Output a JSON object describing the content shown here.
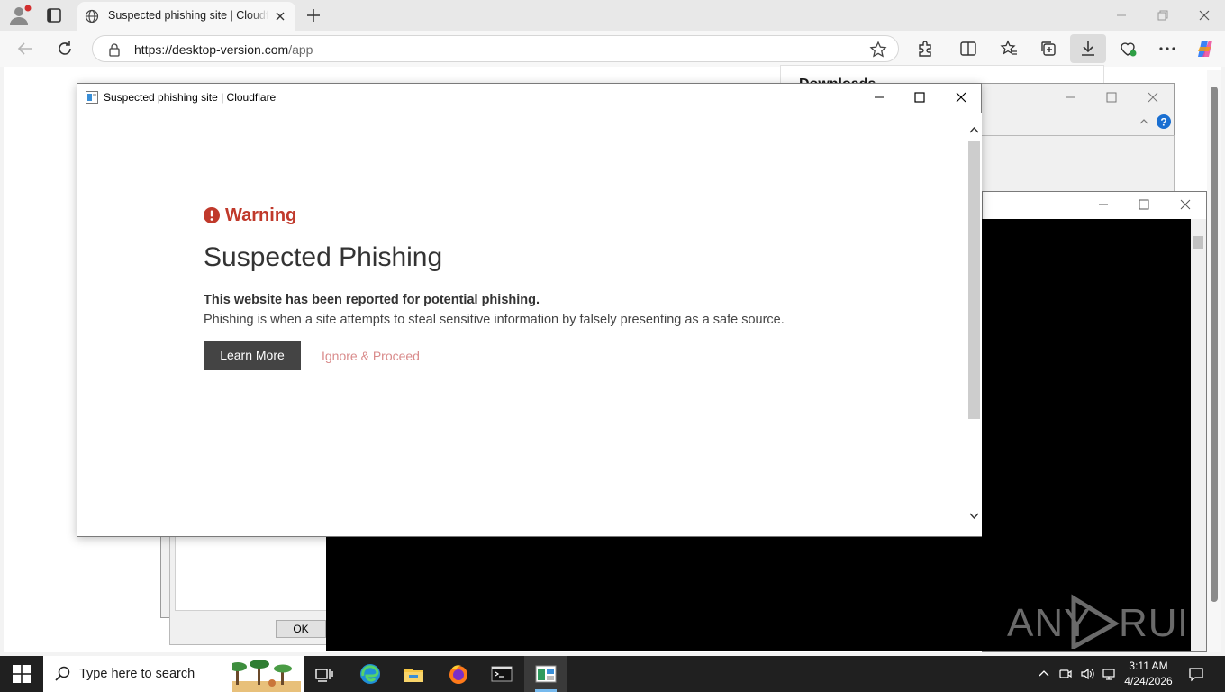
{
  "browser": {
    "tab_title": "Suspected phishing site | Cloudflare",
    "address_url_host": "https://desktop-version.com",
    "address_url_path": "/app"
  },
  "downloads_panel": {
    "title": "Downloads"
  },
  "dialog": {
    "ok_label": "OK"
  },
  "phishing_window": {
    "title": "Suspected phishing site | Cloudflare",
    "warning_label": "Warning",
    "headline": "Suspected Phishing",
    "bold_line": "This website has been reported for potential phishing.",
    "description": "Phishing is when a site attempts to steal sensitive information by falsely presenting as a safe source.",
    "learn_more_label": "Learn More",
    "ignore_label": "Ignore & Proceed",
    "warning_color": "#c0392b"
  },
  "taskbar": {
    "search_placeholder": "Type here to search",
    "time": "3:11 AM",
    "date": "4/24/2026",
    "apps": [
      "task-view",
      "edge",
      "file-explorer",
      "firefox",
      "terminal",
      "app-window"
    ]
  },
  "watermark": {
    "text": "ANY RUN"
  }
}
